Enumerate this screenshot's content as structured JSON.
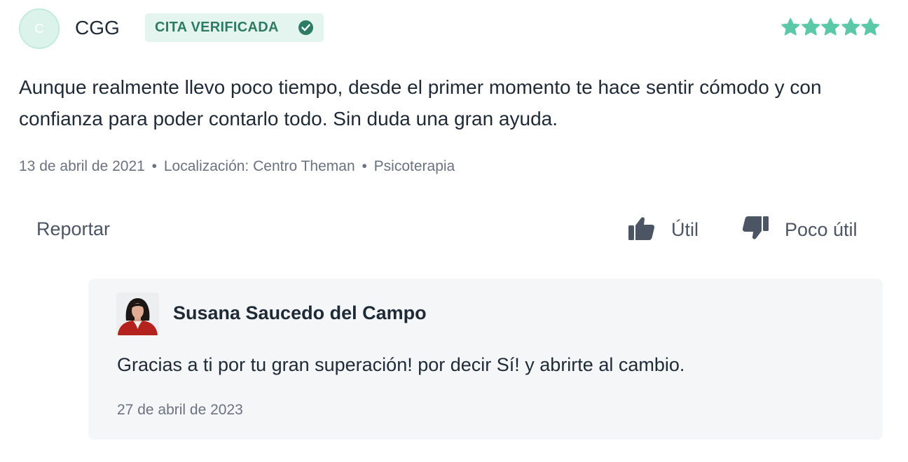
{
  "review": {
    "avatar_initial": "C",
    "username": "CGG",
    "badge": "CITA VERIFICADA",
    "rating": 5,
    "rating_max": 5,
    "star_color": "#5bc9a7",
    "text": "Aunque realmente llevo poco tiempo, desde el primer momento te hace sentir cómodo y con confianza para poder contarlo todo. Sin duda una gran ayuda.",
    "date": "13 de abril de 2021",
    "location": "Localización: Centro Theman",
    "service": "Psicoterapia",
    "separator": "•"
  },
  "actions": {
    "report": "Reportar",
    "useful": "Útil",
    "not_useful": "Poco útil",
    "useful_icon": "thumbs-up-icon",
    "not_useful_icon": "thumbs-down-icon"
  },
  "reply": {
    "name": "Susana Saucedo del Campo",
    "text": "Gracias a ti por tu gran superación! por decir Sí! y abrirte al cambio.",
    "date": "27 de abril de 2023"
  },
  "colors": {
    "accent": "#2f7a63",
    "badge_bg": "#e4f5ef",
    "reply_bg": "#f5f6f8"
  }
}
